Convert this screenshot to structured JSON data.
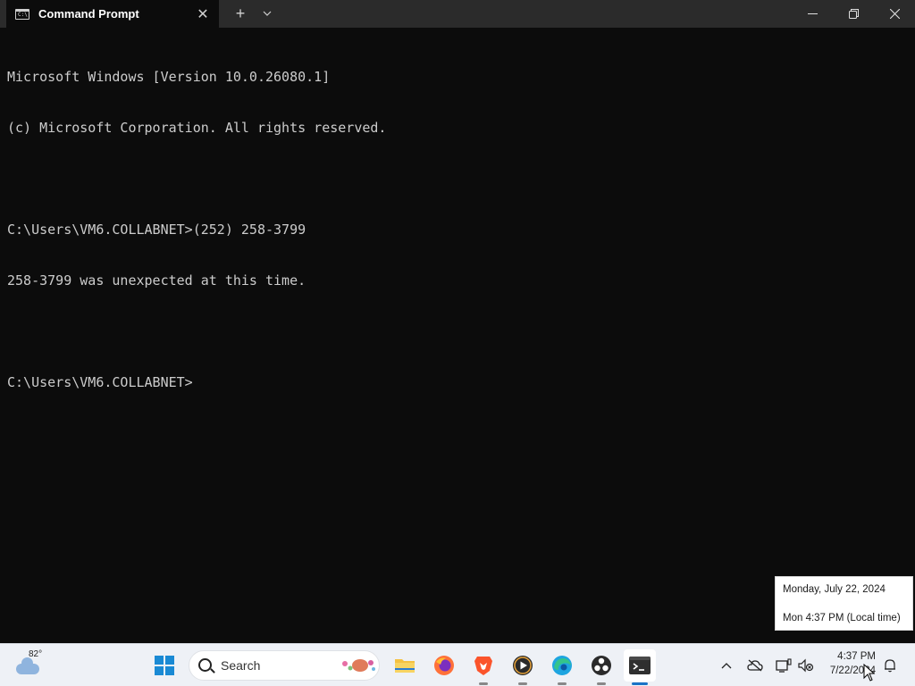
{
  "window": {
    "tab_title": "Command Prompt",
    "tab_icon_text": "C:\\",
    "close_tab_glyph": "✕",
    "new_tab_glyph": "+",
    "dropdown_glyph": "⌄"
  },
  "console": {
    "lines": [
      "Microsoft Windows [Version 10.0.26080.1]",
      "(c) Microsoft Corporation. All rights reserved.",
      "",
      "C:\\Users\\VM6.COLLABNET>(252) 258-3799",
      "258-3799 was unexpected at this time.",
      "",
      "C:\\Users\\VM6.COLLABNET>"
    ]
  },
  "tooltip": {
    "date_line": "Monday, July 22, 2024",
    "time_line": "Mon 4:37 PM (Local time)"
  },
  "taskbar": {
    "weather_temp": "82°",
    "search_placeholder": "Search",
    "clock_time": "4:37 PM",
    "clock_date": "7/22/2024",
    "pinned_apps": [
      "file-explorer",
      "firefox",
      "brave",
      "media-player",
      "edge",
      "obs",
      "terminal"
    ]
  },
  "colors": {
    "console_bg": "#0c0c0c",
    "console_text": "#cccccc",
    "titlebar_bg": "#2b2b2b",
    "taskbar_bg": "#eef1f6",
    "accent": "#1a73c6"
  }
}
